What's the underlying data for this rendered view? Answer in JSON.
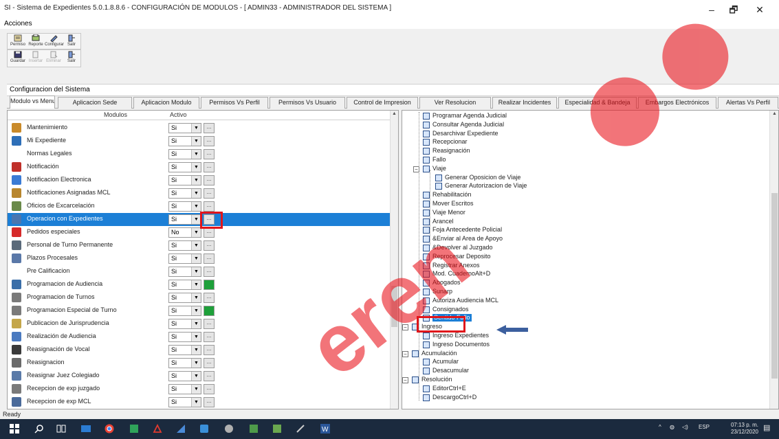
{
  "window": {
    "title": "SI - Sistema de Expedientes 5.0.1.8.8.6 - CONFIGURACIÓN DE MODULOS - [ ADMIN33 - ADMINISTRADOR DEL SISTEMA ]",
    "minimize": "–",
    "maximize": "🗗",
    "close": "✕"
  },
  "menu": {
    "acciones": "Acciones"
  },
  "toolbar1": [
    {
      "label": "Permiso",
      "icon": "permission-icon"
    },
    {
      "label": "Reporte",
      "icon": "report-icon"
    },
    {
      "label": "Configurar",
      "icon": "configure-icon"
    },
    {
      "label": "Salir",
      "icon": "exit-icon"
    }
  ],
  "toolbar2": [
    {
      "label": "Guardar",
      "icon": "save-icon"
    },
    {
      "label": "Insertar",
      "icon": "insert-icon"
    },
    {
      "label": "Eliminar",
      "icon": "delete-icon"
    },
    {
      "label": "Salir",
      "icon": "exit-icon"
    }
  ],
  "config_header": "Configuracion del Sistema",
  "tabs": [
    "Modulo vs Menu",
    "Aplicacion Sede",
    "Aplicacion Modulo",
    "Permisos Vs Perfil",
    "Permisos Vs Usuario",
    "Control de Impresion",
    "Ver Resolucion",
    "Realizar Incidentes",
    "Especialidad & Bandeja",
    "Embargos Electrónicos",
    "Alertas Vs Perfil"
  ],
  "grid": {
    "col_modulos": "Modulos",
    "col_activo": "Activo",
    "rows": [
      {
        "label": "Mantenimiento",
        "value": "Si",
        "icon_color": "#c98a2a"
      },
      {
        "label": "Mi Expediente",
        "value": "Si",
        "icon_color": "#2e6fb8"
      },
      {
        "label": "Normas Legales",
        "value": "Si",
        "icon_color": ""
      },
      {
        "label": "Notificación",
        "value": "Si",
        "icon_color": "#c0302a"
      },
      {
        "label": "Notificacion Electronica",
        "value": "Si",
        "icon_color": "#3a7bd5"
      },
      {
        "label": "Notificaciones Asignadas MCL",
        "value": "Si",
        "icon_color": "#b8862e"
      },
      {
        "label": "Oficios de Excarcelación",
        "value": "Si",
        "icon_color": "#6a8a4a"
      },
      {
        "label": "Operacion con Expedientes",
        "value": "Si",
        "icon_color": "#4a76b0"
      },
      {
        "label": "Pedidos especiales",
        "value": "No",
        "icon_color": "#d62a2a"
      },
      {
        "label": "Personal de Turno Permanente",
        "value": "Si",
        "icon_color": "#5a6a7a"
      },
      {
        "label": "Plazos Procesales",
        "value": "Si",
        "icon_color": "#5a78a8"
      },
      {
        "label": "Pre Calificacion",
        "value": "Si",
        "icon_color": ""
      },
      {
        "label": "Programacion de Audiencia",
        "value": "Si",
        "icon_color": "#3a6ea8"
      },
      {
        "label": "Programacion de Turnos",
        "value": "Si",
        "icon_color": "#7a7a7a"
      },
      {
        "label": "Programacion Especial de Turno",
        "value": "Si",
        "icon_color": "#7a7a7a"
      },
      {
        "label": "Publicacion de Jurisprudencia",
        "value": "Si",
        "icon_color": "#c4a64a"
      },
      {
        "label": "Realización de Audiencia",
        "value": "Si",
        "icon_color": "#4a7ac0"
      },
      {
        "label": "Reasignación de Vocal",
        "value": "Si",
        "icon_color": "#3a3a3a"
      },
      {
        "label": "Reasignacion",
        "value": "Si",
        "icon_color": "#6a6a6a"
      },
      {
        "label": "Reasignar Juez Colegiado",
        "value": "Si",
        "icon_color": "#5a7aa8"
      },
      {
        "label": "Recepcion de exp juzgado",
        "value": "Si",
        "icon_color": "#7a7a7a"
      },
      {
        "label": "Recepcion de exp MCL",
        "value": "Si",
        "icon_color": "#4a6a9a"
      }
    ]
  },
  "tree": [
    {
      "label": "Programar Agenda Judicial",
      "level": 1
    },
    {
      "label": "Consultar Agenda Judicial",
      "level": 1
    },
    {
      "label": "Desarchivar Expediente",
      "level": 1
    },
    {
      "label": "Recepcionar",
      "level": 1
    },
    {
      "label": "Reasignación",
      "level": 1
    },
    {
      "label": "Fallo",
      "level": 1
    },
    {
      "label": "Viaje",
      "level": 1,
      "expander": "−"
    },
    {
      "label": "Generar Oposicion de Viaje",
      "level": 2
    },
    {
      "label": "Generar Autorizacion de Viaje",
      "level": 2
    },
    {
      "label": "Rehabilitación",
      "level": 1
    },
    {
      "label": "Mover Escritos",
      "level": 1
    },
    {
      "label": "Viaje Menor",
      "level": 1
    },
    {
      "label": "Arancel",
      "level": 1
    },
    {
      "label": "Foja Antecedente Policial",
      "level": 1
    },
    {
      "label": "&Enviar al Area de Apoyo",
      "level": 1
    },
    {
      "label": "&Devolver al Juzgado",
      "level": 1
    },
    {
      "label": "Reprocesar Deposito",
      "level": 1
    },
    {
      "label": "Registrar Anexos",
      "level": 1
    },
    {
      "label": "Mod. CuadernoAlt+D",
      "level": 1
    },
    {
      "label": "Abogados",
      "level": 1
    },
    {
      "label": "Sunarp",
      "level": 1
    },
    {
      "label": "Autoriza Audiencia MCL",
      "level": 1
    },
    {
      "label": "Consignados",
      "level": 1
    },
    {
      "label": "Sentido Fallo",
      "level": 1,
      "highlight": true
    },
    {
      "label": "Ingreso",
      "level": 0,
      "expander": "−"
    },
    {
      "label": "Ingreso Expedientes",
      "level": 1
    },
    {
      "label": "Ingreso Documentos",
      "level": 1
    },
    {
      "label": "Acumulación",
      "level": 0,
      "expander": "−"
    },
    {
      "label": "Acumular",
      "level": 1
    },
    {
      "label": "Desacumular",
      "level": 1
    },
    {
      "label": "Resolución",
      "level": 0,
      "expander": "−"
    },
    {
      "label": "EditorCtrl+E",
      "level": 1
    },
    {
      "label": "DescargoCtrl+D",
      "level": 1
    }
  ],
  "status": "Ready",
  "taskbar": {
    "tray_lang": "ESP",
    "clock_time": "07:13 p. m.",
    "clock_date": "23/12/2020"
  }
}
